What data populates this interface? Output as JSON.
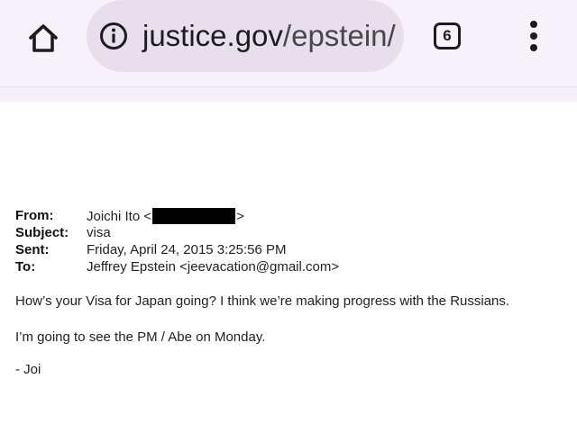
{
  "browser": {
    "url_domain": "justice.gov",
    "url_path": "/epstein/",
    "tab_count": "6",
    "icons": {
      "home": "home-icon",
      "info": "info-icon",
      "tabs": "tab-switcher-icon",
      "menu": "more-vert-icon"
    }
  },
  "email": {
    "from_label": "From:",
    "from_name": "Joichi Ito <",
    "from_suffix": ">",
    "subject_label": "Subject:",
    "subject_value": "visa",
    "sent_label": "Sent:",
    "sent_value": "Friday, April 24, 2015 3:25:56 PM",
    "to_label": "To:",
    "to_value": "Jeffrey Epstein <jeevacation@gmail.com>",
    "body": [
      "How’s your Visa for Japan going? I think we’re making progress with the Russians.",
      "I’m going to see the PM / Abe on Monday.",
      "- Joi"
    ]
  }
}
